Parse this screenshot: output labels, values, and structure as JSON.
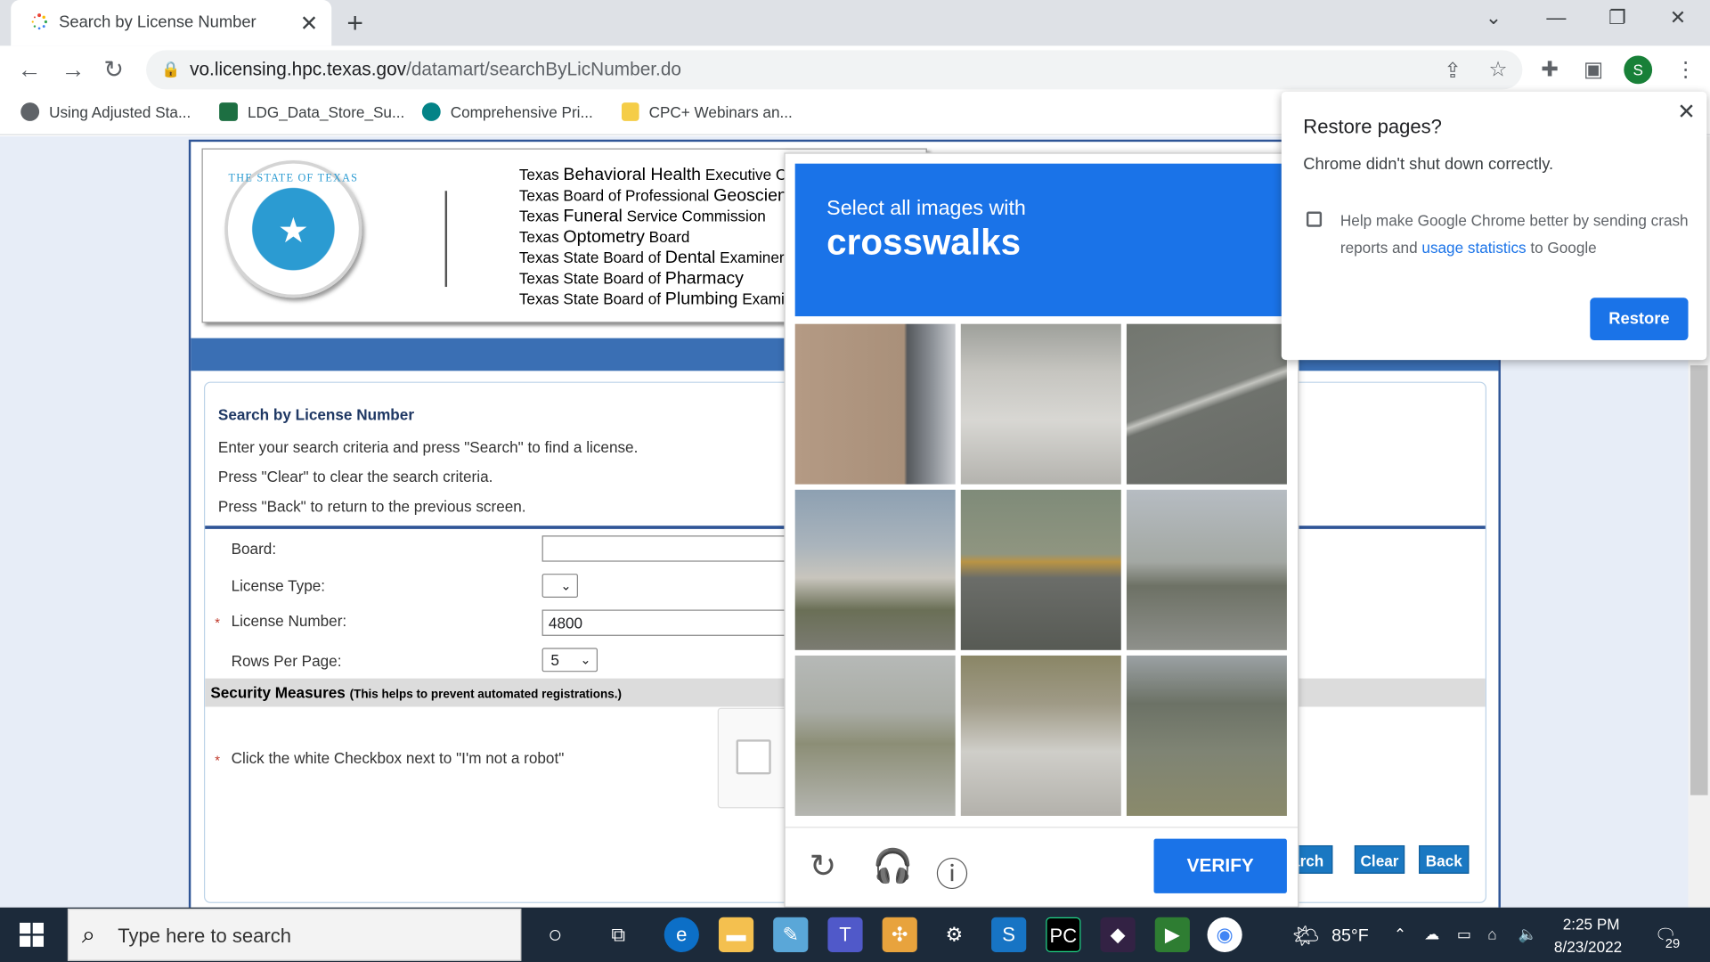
{
  "browser": {
    "tab_title": "Search by License Number",
    "url_host": "vo.licensing.hpc.texas.gov",
    "url_path": "/datamart/searchByLicNumber.do",
    "bookmarks": [
      {
        "label": "Using Adjusted Sta...",
        "icon": "globe-icon"
      },
      {
        "label": "LDG_Data_Store_Su...",
        "icon": "excel-icon"
      },
      {
        "label": "Comprehensive Pri...",
        "icon": "sharepoint-icon"
      },
      {
        "label": "CPC+ Webinars an...",
        "icon": "folder-icon"
      }
    ],
    "profile_initial": "S"
  },
  "header": {
    "seal_text": "THE STATE OF TEXAS",
    "boards": [
      {
        "pre": "Texas ",
        "big": "Behavioral Health",
        "post": " Executive Co"
      },
      {
        "pre": "Texas Board of Professional ",
        "big": "Geoscient",
        "post": ""
      },
      {
        "pre": "Texas ",
        "big": "Funeral",
        "post": " Service Commission"
      },
      {
        "pre": "Texas ",
        "big": "Optometry",
        "post": " Board"
      },
      {
        "pre": "Texas State Board of ",
        "big": "Dental",
        "post": " Examiners"
      },
      {
        "pre": "Texas State Board of ",
        "big": "Pharmacy",
        "post": ""
      },
      {
        "pre": "Texas State Board of ",
        "big": "Plumbing",
        "post": " Examir"
      }
    ]
  },
  "form": {
    "title": "Search by License Number",
    "instructions": [
      "Enter your search criteria and press \"Search\" to find a license.",
      "Press \"Clear\" to clear the search criteria.",
      "Press \"Back\" to return to the previous screen."
    ],
    "board_label": "Board:",
    "board_value": "",
    "license_type_label": "License Type:",
    "license_type_value": "",
    "license_number_label": "License Number:",
    "license_number_value": "4800",
    "rows_label": "Rows Per Page:",
    "rows_value": "5",
    "security_title": "Security Measures",
    "security_note": "(This helps to prevent automated registrations.)",
    "robot_instruction": "Click the white Checkbox next to \"I'm not a robot\"",
    "search_label": "arch",
    "clear_label": "Clear",
    "back_label": "Back",
    "required_mark": "*"
  },
  "captcha": {
    "prompt": "Select all images with",
    "target": "crosswalks",
    "verify_label": "VERIFY"
  },
  "restore_dialog": {
    "title": "Restore pages?",
    "message": "Chrome didn't shut down correctly.",
    "checkbox_text_1": "Help make Google Chrome better by sending crash reports and ",
    "checkbox_link": "usage statistics",
    "checkbox_text_2": " to Google",
    "button_label": "Restore"
  },
  "taskbar": {
    "search_placeholder": "Type here to search",
    "weather": "85°F",
    "time": "2:25 PM",
    "date": "8/23/2022",
    "notifications": "29"
  }
}
